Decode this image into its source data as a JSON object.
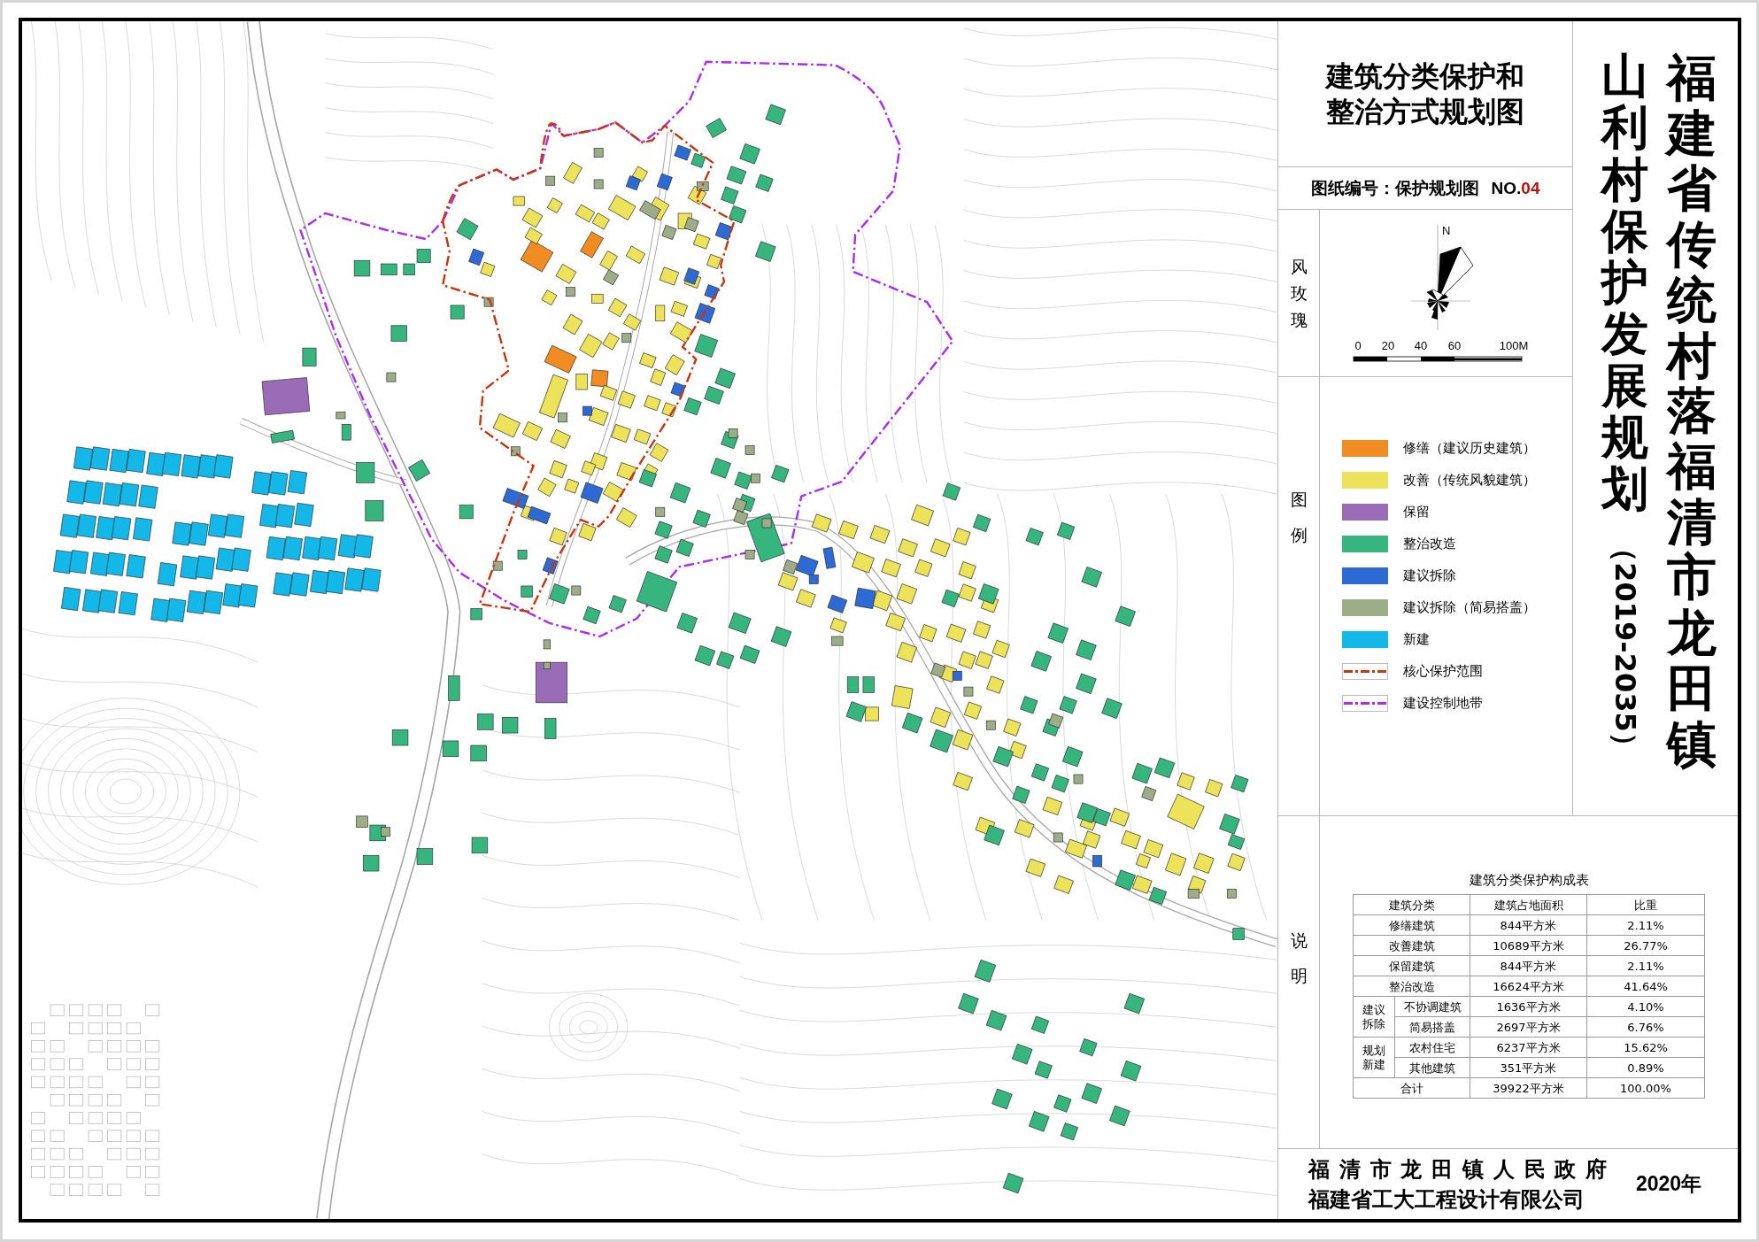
{
  "title_block": {
    "title": "建筑分类保护和整治方式规划图"
  },
  "drawing_number": {
    "label": "图纸编号：保护规划图",
    "prefix": "NO.",
    "number": "04"
  },
  "project_title": {
    "plan_name": "山利村保护发展规划",
    "period": "（2019-2035）",
    "region": "福建省传统村落福清市龙田镇"
  },
  "wind_rose": {
    "label": "风玫瑰",
    "north": "N",
    "scale_labels": [
      "0",
      "20",
      "40",
      "60",
      "100M"
    ]
  },
  "legend": {
    "label": "图例",
    "items": [
      {
        "kind": "fill",
        "color": "#f08c22",
        "label": "修缮（建议历史建筑）"
      },
      {
        "kind": "fill",
        "color": "#ece35b",
        "label": "改善（传统风貌建筑）"
      },
      {
        "kind": "fill",
        "color": "#9a6cb8",
        "label": "保留"
      },
      {
        "kind": "fill",
        "color": "#37b57e",
        "label": "整治改造"
      },
      {
        "kind": "fill",
        "color": "#2e6ad3",
        "label": "建议拆除"
      },
      {
        "kind": "fill",
        "color": "#9cad88",
        "label": "建议拆除（简易搭盖）"
      },
      {
        "kind": "fill",
        "color": "#14b8e8",
        "label": "新建"
      },
      {
        "kind": "line",
        "color": "#c7370f",
        "label": "核心保护范围"
      },
      {
        "kind": "line",
        "color": "#a92cf0",
        "label": "建设控制地带"
      }
    ]
  },
  "notes": {
    "label": "说明",
    "table": {
      "title": "建筑分类保护构成表",
      "columns": [
        "建筑分类",
        "建筑占地面积",
        "比重"
      ],
      "rows": [
        {
          "kind": "single",
          "category": "修缮建筑",
          "area": "844平方米",
          "share": "2.11%"
        },
        {
          "kind": "single",
          "category": "改善建筑",
          "area": "10689平方米",
          "share": "26.77%"
        },
        {
          "kind": "single",
          "category": "保留建筑",
          "area": "844平方米",
          "share": "2.11%"
        },
        {
          "kind": "single",
          "category": "整治改造",
          "area": "16624平方米",
          "share": "41.64%"
        },
        {
          "kind": "group",
          "group": "建议拆除",
          "items": [
            {
              "category": "不协调建筑",
              "area": "1636平方米",
              "share": "4.10%"
            },
            {
              "category": "简易搭盖",
              "area": "2697平方米",
              "share": "6.76%"
            }
          ]
        },
        {
          "kind": "group",
          "group": "规划新建",
          "items": [
            {
              "category": "农村住宅",
              "area": "6237平方米",
              "share": "15.62%"
            },
            {
              "category": "其他建筑",
              "area": "351平方米",
              "share": "0.89%"
            }
          ]
        },
        {
          "kind": "single",
          "category": "合计",
          "area": "39922平方米",
          "share": "100.00%"
        }
      ]
    }
  },
  "footer": {
    "authors": [
      "福清市龙田镇人民政府",
      "福建省工大工程设计有限公司"
    ],
    "year": "2020年"
  }
}
